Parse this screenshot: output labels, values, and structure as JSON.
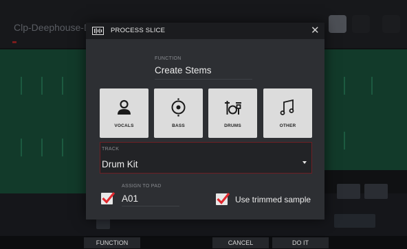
{
  "background": {
    "sequence_name": "Clp-Deephouse-D"
  },
  "dialog": {
    "title": "PROCESS SLICE",
    "close_glyph": "✕",
    "function": {
      "label": "FUNCTION",
      "value": "Create Stems"
    },
    "stems": [
      {
        "label": "VOCALS",
        "icon": "person-icon"
      },
      {
        "label": "BASS",
        "icon": "speaker-icon"
      },
      {
        "label": "DRUMS",
        "icon": "drum-kit-icon"
      },
      {
        "label": "OTHER",
        "icon": "music-note-icon"
      }
    ],
    "track": {
      "label": "TRACK",
      "value": "Drum Kit"
    },
    "assign_to_pad": {
      "label": "ASSIGN TO PAD",
      "value": "A01",
      "checked": true
    },
    "use_trimmed": {
      "label": "Use trimmed sample",
      "checked": true
    }
  },
  "function_bar": {
    "function": "FUNCTION",
    "cancel": "CANCEL",
    "do_it": "DO IT"
  },
  "colors": {
    "dialog_bg": "#2d2f33",
    "header_bg": "#1b1c1f",
    "accent_red": "#e0282e",
    "stem_button_bg": "#dcdcdc",
    "waveform_green": "#123a2a"
  }
}
